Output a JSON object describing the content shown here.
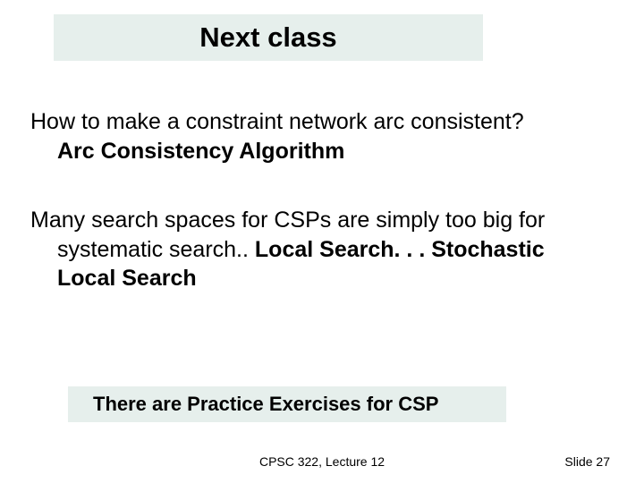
{
  "title": "Next class",
  "para1_line1": "How to make a constraint network arc consistent?",
  "para1_line2": "Arc Consistency Algorithm",
  "para2_line1": "Many search spaces for CSPs are simply too big for",
  "para2_line2a": "systematic search.. ",
  "para2_line2b": "Local Search. . . Stochastic",
  "para2_line3": "Local Search",
  "practice": "There are Practice Exercises for CSP",
  "footer_center": "CPSC 322, Lecture 12",
  "footer_right": "Slide 27"
}
